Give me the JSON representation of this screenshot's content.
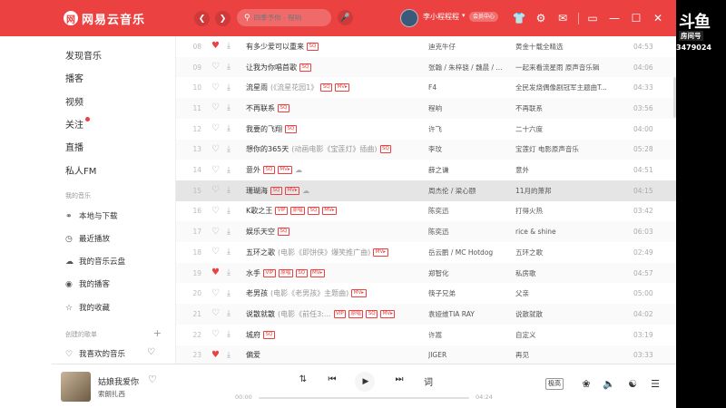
{
  "app": {
    "name": "网易云音乐",
    "logo_glyph": "网"
  },
  "header": {
    "search_placeholder": "四季予你 - 程响",
    "username": "李小程程程",
    "vip_label": "会员中心",
    "icons": [
      "back-icon",
      "forward-icon",
      "search-icon",
      "mic-icon",
      "skin-icon",
      "settings-icon",
      "mail-icon",
      "mini-mode-icon",
      "minimize-icon",
      "maximize-icon",
      "close-icon"
    ]
  },
  "sidebar": {
    "main": [
      {
        "label": "发现音乐"
      },
      {
        "label": "播客"
      },
      {
        "label": "视频"
      },
      {
        "label": "关注"
      },
      {
        "label": "直播"
      },
      {
        "label": "私人FM"
      }
    ],
    "section_mine": "我的音乐",
    "mine": [
      {
        "label": "本地与下载",
        "icon": "download-icon"
      },
      {
        "label": "最近播放",
        "icon": "clock-icon"
      },
      {
        "label": "我的音乐云盘",
        "icon": "cloud-icon"
      },
      {
        "label": "我的播客",
        "icon": "podcast-icon"
      },
      {
        "label": "我的收藏",
        "icon": "star-icon"
      }
    ],
    "section_created": "创建的歌单",
    "created": [
      {
        "label": "我喜欢的音乐",
        "icon": "heart-icon"
      }
    ]
  },
  "songs": [
    {
      "num": "08",
      "liked": true,
      "title": "有多少爱可以重来",
      "sub": "",
      "tags": [
        "SQ"
      ],
      "cloud": false,
      "artist": "迪克牛仔",
      "album": "黄金十载全精选",
      "duration": "04:53"
    },
    {
      "num": "09",
      "liked": false,
      "title": "让我为你唱首歌",
      "sub": "",
      "tags": [
        "SQ"
      ],
      "cloud": false,
      "artist": "张翰 / 朱梓骁 / 魏晨 / ...",
      "album": "一起来看流星雨 原声音乐辑",
      "duration": "04:06"
    },
    {
      "num": "10",
      "liked": false,
      "title": "流星雨",
      "sub": "(《流星花园1》",
      "tags": [
        "SQ",
        "MV▸"
      ],
      "cloud": false,
      "artist": "F4",
      "album": "全民发烧偶像剧冠军主题曲T...",
      "duration": "04:33"
    },
    {
      "num": "11",
      "liked": false,
      "title": "不再联系",
      "sub": "",
      "tags": [
        "SQ"
      ],
      "cloud": false,
      "artist": "程响",
      "album": "不再联系",
      "duration": "03:56"
    },
    {
      "num": "12",
      "liked": false,
      "title": "我要的飞翔",
      "sub": "",
      "tags": [
        "SQ"
      ],
      "cloud": false,
      "artist": "许飞",
      "album": "二十六度",
      "duration": "04:00"
    },
    {
      "num": "13",
      "liked": false,
      "title": "想你的365天",
      "sub": "(动画电影《宝莲灯》插曲)",
      "tags": [
        "SQ"
      ],
      "cloud": false,
      "artist": "李玟",
      "album": "宝莲灯 电影原声音乐",
      "duration": "05:28"
    },
    {
      "num": "14",
      "liked": false,
      "title": "意外",
      "sub": "",
      "tags": [
        "SQ",
        "MV▸"
      ],
      "cloud": true,
      "artist": "薛之谦",
      "album": "意外",
      "duration": "04:51"
    },
    {
      "num": "15",
      "liked": false,
      "title": "珊瑚海",
      "sub": "",
      "tags": [
        "SQ",
        "MV▸"
      ],
      "cloud": true,
      "artist": "周杰伦 / 梁心颐",
      "album": "11月的萧邦",
      "duration": "04:15"
    },
    {
      "num": "16",
      "liked": false,
      "title": "K歌之王",
      "sub": "",
      "tags": [
        "VIP",
        "原唱",
        "SQ",
        "MV▸"
      ],
      "cloud": false,
      "artist": "陈奕迅",
      "album": "打得火热",
      "duration": "03:42"
    },
    {
      "num": "17",
      "liked": false,
      "title": "娱乐天空",
      "sub": "",
      "tags": [
        "SQ"
      ],
      "cloud": false,
      "artist": "陈奕迅",
      "album": "rice & shine",
      "duration": "06:03"
    },
    {
      "num": "18",
      "liked": false,
      "title": "五环之歌",
      "sub": "(电影《即饼侠》爆笑推广曲)",
      "tags": [
        "MV▸"
      ],
      "cloud": false,
      "artist": "岳云鹏 / MC Hotdog",
      "album": "五环之歌",
      "duration": "02:49"
    },
    {
      "num": "19",
      "liked": true,
      "title": "水手",
      "sub": "",
      "tags": [
        "VIP",
        "原唱",
        "SQ",
        "MV▸"
      ],
      "cloud": false,
      "artist": "郑智化",
      "album": "私房歌",
      "duration": "04:57"
    },
    {
      "num": "20",
      "liked": false,
      "title": "老男孩",
      "sub": "(电影《老男孩》主题曲)",
      "tags": [
        "MV▸"
      ],
      "cloud": false,
      "artist": "筷子兄弟",
      "album": "父亲",
      "duration": "05:00"
    },
    {
      "num": "21",
      "liked": false,
      "title": "说散就散",
      "sub": "(电影《前任3:...",
      "tags": [
        "VIP",
        "原唱",
        "SQ",
        "MV▸"
      ],
      "cloud": false,
      "artist": "袁娅维TIA RAY",
      "album": "说散就散",
      "duration": "04:02"
    },
    {
      "num": "22",
      "liked": false,
      "title": "城府",
      "sub": "",
      "tags": [
        "SQ"
      ],
      "cloud": false,
      "artist": "许嵩",
      "album": "自定义",
      "duration": "03:19"
    },
    {
      "num": "23",
      "liked": true,
      "title": "偏爱",
      "sub": "",
      "tags": [],
      "cloud": false,
      "artist": "JIGER",
      "album": "再见",
      "duration": "03:33"
    }
  ],
  "selected_song_num": "15",
  "player": {
    "title": "姑娘我爱你",
    "artist": "索朗扎西",
    "current_time": "00:00",
    "total_time": "04:24",
    "progress": 0,
    "lyrics_label": "词",
    "quality_label": "极高",
    "colors": {
      "accent": "#ec4141"
    }
  },
  "overlay": {
    "logo": "斗鱼",
    "room_label": "房间号",
    "room_id": "3479024"
  }
}
